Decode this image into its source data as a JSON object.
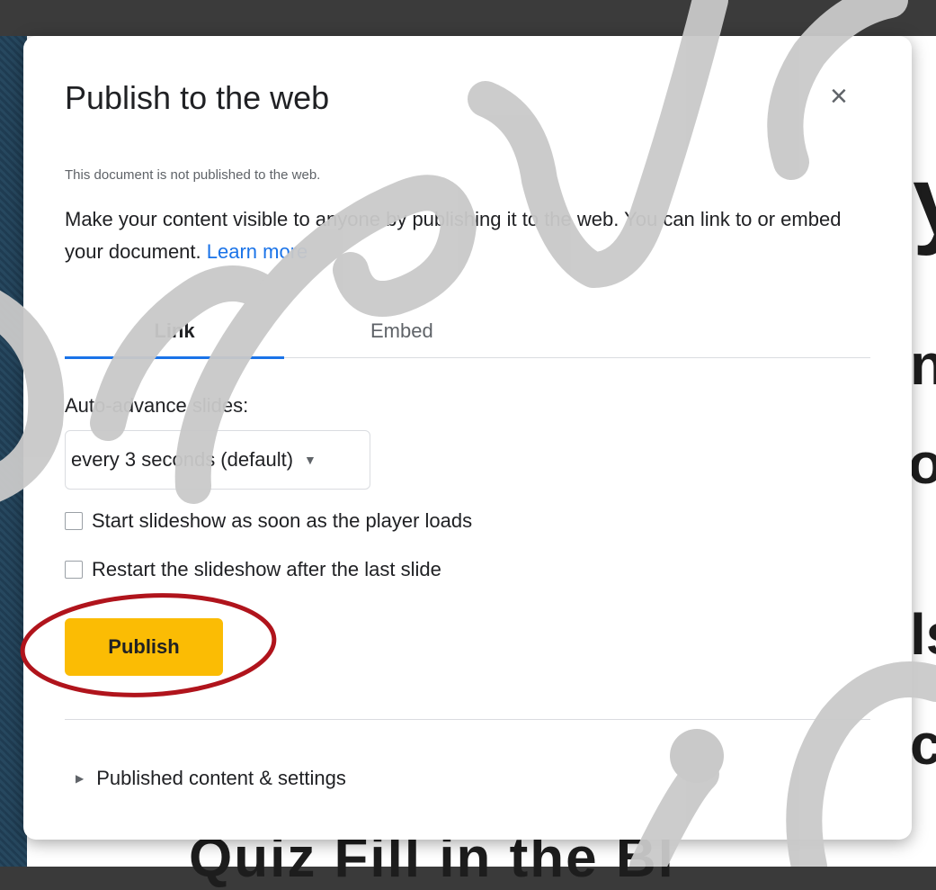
{
  "background": {
    "slide_letters": [
      "y",
      "n",
      "o",
      "ls",
      "c"
    ],
    "slide_bottom_text": "Quiz     Fill in the Bl"
  },
  "dialog": {
    "title": "Publish to the web",
    "close_icon": "close-icon",
    "status": "This document is not published to the web.",
    "description": "Make your content visible to anyone by publishing it to the web. You can link to or embed your document.",
    "learn_more": "Learn more",
    "tabs": [
      {
        "label": "Link",
        "active": true
      },
      {
        "label": "Embed",
        "active": false
      }
    ],
    "auto_advance_label": "Auto-advance slides:",
    "auto_advance_value": "every 3 seconds (default)",
    "checkboxes": [
      {
        "label": "Start slideshow as soon as the player loads",
        "checked": false
      },
      {
        "label": "Restart the slideshow after the last slide",
        "checked": false
      }
    ],
    "publish_label": "Publish",
    "settings_label": "Published content & settings"
  },
  "colors": {
    "publish_button": "#fbbc04",
    "tab_accent": "#1a73e8",
    "annotation_circle": "#b0141c",
    "watermark": "#c9c9c9"
  }
}
